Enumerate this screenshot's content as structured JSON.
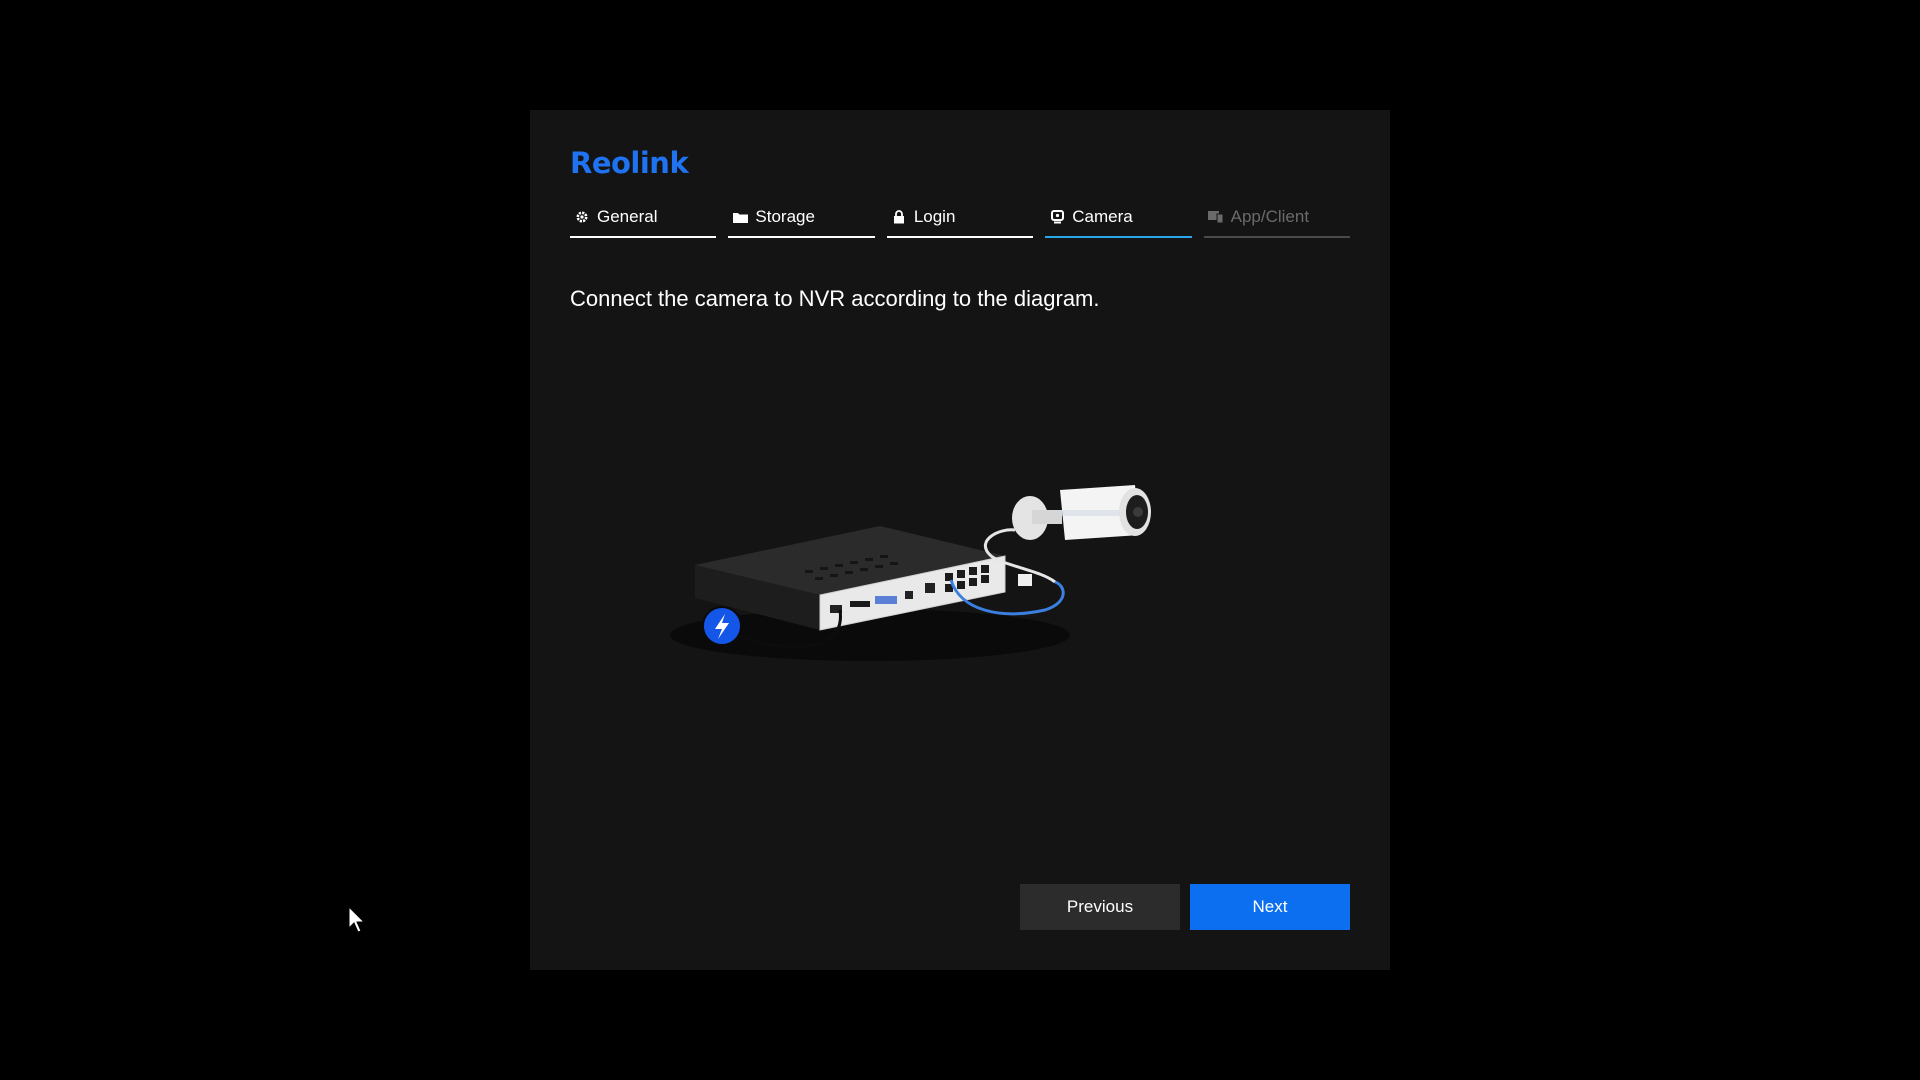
{
  "brand": {
    "logo_text": "Reolink",
    "accent": "#1f73f0"
  },
  "wizard": {
    "tabs": [
      {
        "label": "General",
        "icon": "gear-icon",
        "state": "done"
      },
      {
        "label": "Storage",
        "icon": "folder-icon",
        "state": "done"
      },
      {
        "label": "Login",
        "icon": "lock-icon",
        "state": "done"
      },
      {
        "label": "Camera",
        "icon": "camera-icon",
        "state": "active"
      },
      {
        "label": "App/Client",
        "icon": "devices-icon",
        "state": "disabled"
      }
    ],
    "active_tab_color": "#2aa6e8"
  },
  "content": {
    "instruction": "Connect the camera to NVR according to the diagram."
  },
  "diagram": {
    "power_icon": "lightning-icon",
    "power_color": "#1456e8",
    "cable_color": "#3b7fe0"
  },
  "buttons": {
    "previous_label": "Previous",
    "next_label": "Next",
    "next_color": "#0b6ff0"
  }
}
